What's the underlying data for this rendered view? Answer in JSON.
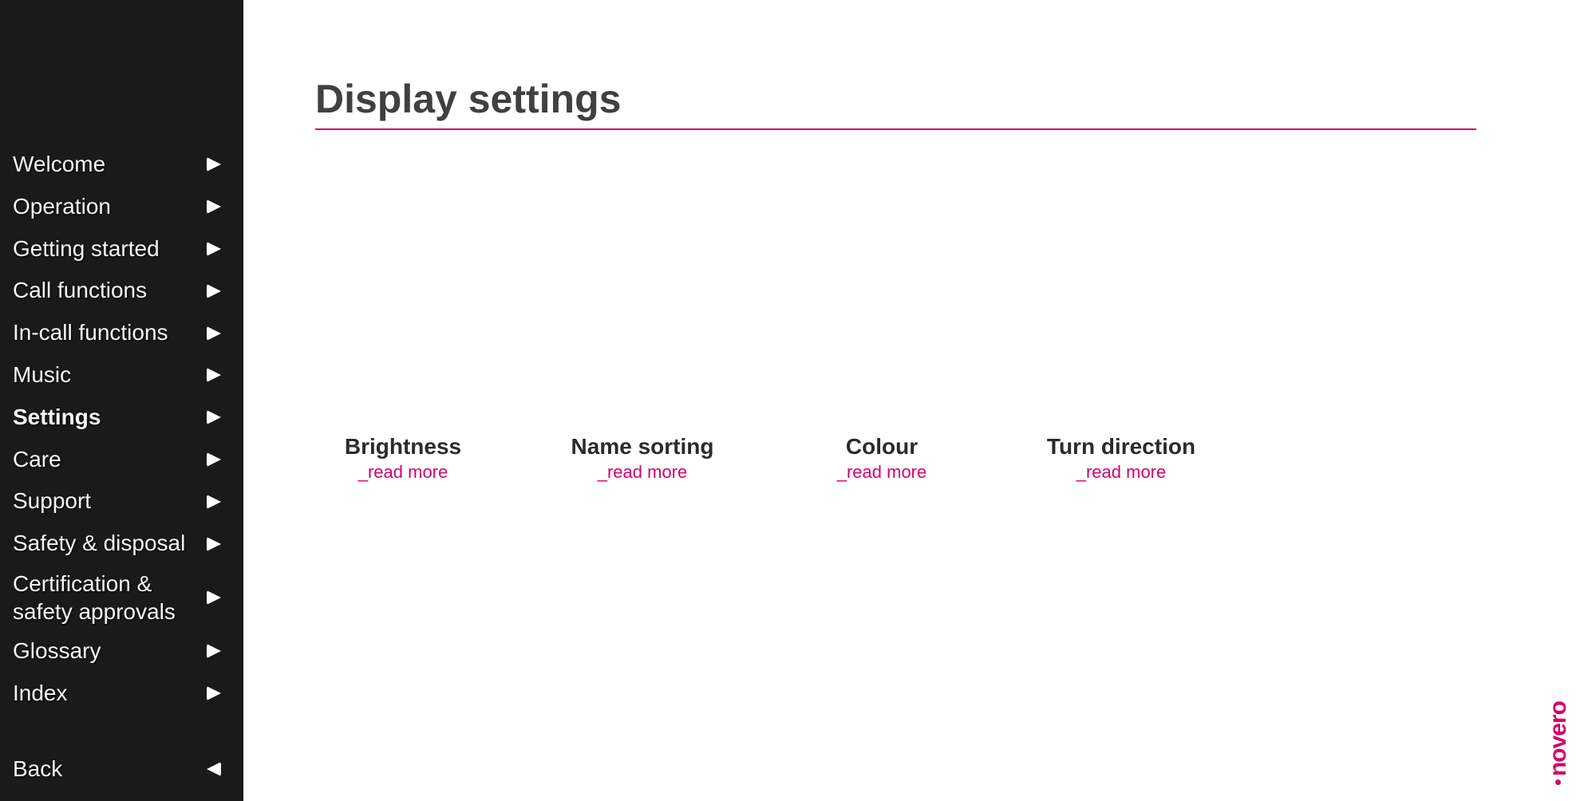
{
  "sidebar": {
    "items": [
      {
        "label": "Welcome"
      },
      {
        "label": "Operation"
      },
      {
        "label": "Getting started"
      },
      {
        "label": "Call functions"
      },
      {
        "label": "In-call functions"
      },
      {
        "label": "Music"
      },
      {
        "label": "Settings",
        "active": true
      },
      {
        "label": "Care"
      },
      {
        "label": "Support"
      },
      {
        "label": "Safety & disposal"
      },
      {
        "label": "Certification &\nsafety approvals",
        "multiline": true
      },
      {
        "label": "Glossary"
      },
      {
        "label": "Index"
      }
    ],
    "back_label": "Back"
  },
  "main": {
    "title": "Display settings",
    "tiles": [
      {
        "title": "Brightness",
        "link": "_read more"
      },
      {
        "title": "Name sorting",
        "link": "_read more"
      },
      {
        "title": "Colour",
        "link": "_read more"
      },
      {
        "title": "Turn direction",
        "link": "_read more"
      }
    ]
  },
  "brand": "novero"
}
